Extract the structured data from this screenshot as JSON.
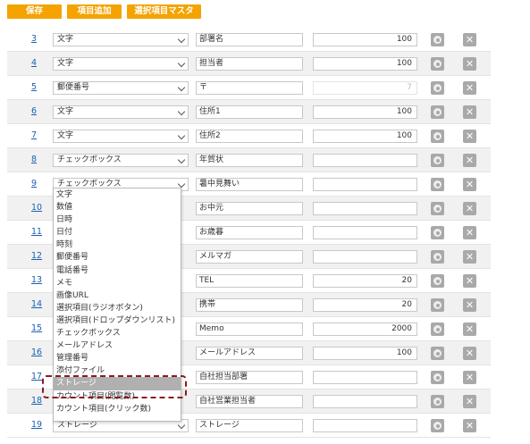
{
  "toolbar": {
    "save_label": "保存",
    "add_label": "項目追加",
    "master_label": "選択項目マスタ"
  },
  "rows": [
    {
      "num": "3",
      "type": "文字",
      "name": "部署名",
      "len": "100"
    },
    {
      "num": "4",
      "type": "文字",
      "name": "担当者",
      "len": "100"
    },
    {
      "num": "5",
      "type": "郵便番号",
      "name": "〒",
      "len": "7",
      "len_disabled": true
    },
    {
      "num": "6",
      "type": "文字",
      "name": "住所1",
      "len": "100"
    },
    {
      "num": "7",
      "type": "文字",
      "name": "住所2",
      "len": "100"
    },
    {
      "num": "8",
      "type": "チェックボックス",
      "name": "年賀状",
      "len": ""
    },
    {
      "num": "9",
      "type": "チェックボックス",
      "name": "暑中見舞い",
      "len": ""
    },
    {
      "num": "10",
      "type": "",
      "name": "お中元",
      "len": ""
    },
    {
      "num": "11",
      "type": "",
      "name": "お歳暮",
      "len": ""
    },
    {
      "num": "12",
      "type": "",
      "name": "メルマガ",
      "len": ""
    },
    {
      "num": "13",
      "type": "",
      "name": "TEL",
      "len": "20"
    },
    {
      "num": "14",
      "type": "",
      "name": "携帯",
      "len": "20"
    },
    {
      "num": "15",
      "type": "",
      "name": "Memo",
      "len": "2000"
    },
    {
      "num": "16",
      "type": "",
      "name": "メールアドレス",
      "len": "100"
    },
    {
      "num": "17",
      "type": "",
      "name": "自社担当部署",
      "len": ""
    },
    {
      "num": "18",
      "type": "",
      "name": "自社営業担当者",
      "len": ""
    },
    {
      "num": "19",
      "type": "ストレージ",
      "name": "ストレージ",
      "len": ""
    }
  ],
  "dropdown_options": [
    "文字",
    "数値",
    "日時",
    "日付",
    "時刻",
    "郵便番号",
    "電話番号",
    "メモ",
    "画像URL",
    "選択項目(ラジオボタン)",
    "選択項目(ドロップダウンリスト)",
    "チェックボックス",
    "メールアドレス",
    "管理番号",
    "添付ファイル",
    "ストレージ",
    "カウント項目(閲覧数)",
    "カウント項目(クリック数)"
  ],
  "highlighted_option": "ストレージ",
  "colors": {
    "accent": "#f4a300",
    "link": "#1a5fb4",
    "callout": "#8b1a1a",
    "highlight": "#b0b0b0"
  },
  "icons": {
    "settings": "gear-icon",
    "delete": "close-icon",
    "dropdown": "chevron-down-icon"
  }
}
